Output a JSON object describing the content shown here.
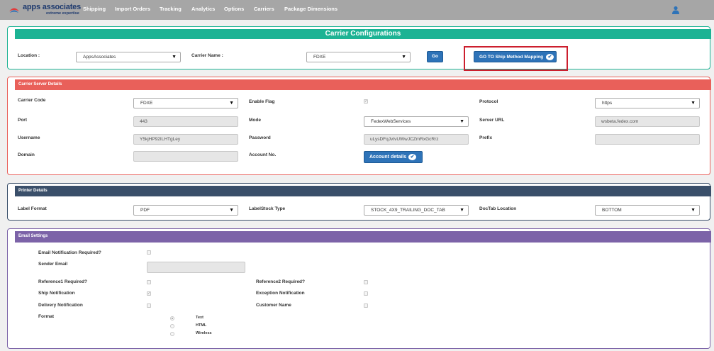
{
  "brand": {
    "name": "apps associates",
    "tagline": "extreme expertise"
  },
  "nav": [
    "Shipping",
    "Import Orders",
    "Tracking",
    "Analytics",
    "Options",
    "Carriers",
    "Package Dimensions"
  ],
  "config": {
    "title": "Carrier Configurations",
    "location_label": "Location :",
    "location_value": "AppsAssociates",
    "carrier_name_label": "Carrier Name :",
    "carrier_name_value": "FDXE",
    "go_label": "Go",
    "mapping_label": "GO TO Ship Method Mapping"
  },
  "server": {
    "title": "Carrier Server Details",
    "carrier_code_label": "Carrier Code",
    "carrier_code_value": "FDXE",
    "enable_flag_label": "Enable Flag",
    "protocol_label": "Protocol",
    "protocol_value": "https",
    "port_label": "Port",
    "port_value": "443",
    "mode_label": "Mode",
    "mode_value": "FedexWebServices",
    "server_url_label": "Server URL",
    "server_url_value": "wsbeta.fedex.com",
    "username_label": "Username",
    "username_value": "Y5kjHP92ILHTgLey",
    "password_label": "Password",
    "password_value": "uLysDFqJvtvUWwJCZmRxGcRrz",
    "prefix_label": "Prefix",
    "prefix_value": "",
    "domain_label": "Domain",
    "domain_value": "",
    "account_no_label": "Account No.",
    "account_details_label": "Account details"
  },
  "printer": {
    "title": "Printer Details",
    "label_format_label": "Label Format",
    "label_format_value": "PDF",
    "labelstock_label": "LabelStock Type",
    "labelstock_value": "STOCK_4X9_TRAILING_DOC_TAB",
    "doctab_label": "DocTab Location",
    "doctab_value": "BOTTOM"
  },
  "email": {
    "title": "Email Settings",
    "notification_required_label": "Email Notification Required?",
    "sender_email_label": "Sender Email",
    "sender_email_value": "",
    "reference1_label": "Reference1 Required?",
    "reference2_label": "Reference2 Required?",
    "ship_notification_label": "Ship Notification",
    "exception_notification_label": "Exception Notification",
    "delivery_notification_label": "Delivery Notification",
    "customer_name_label": "Customer Name",
    "format_label": "Format",
    "format_options": [
      "Text",
      "HTML",
      "Wireless"
    ]
  },
  "colors": {
    "navbar": "#a6a6a6",
    "config_header": "#1cb394",
    "server_header": "#e9605a",
    "printer_header": "#3a4f6a",
    "email_header": "#7c63a8",
    "primary_button": "#2e73b8",
    "highlight": "#cc1f2e"
  }
}
